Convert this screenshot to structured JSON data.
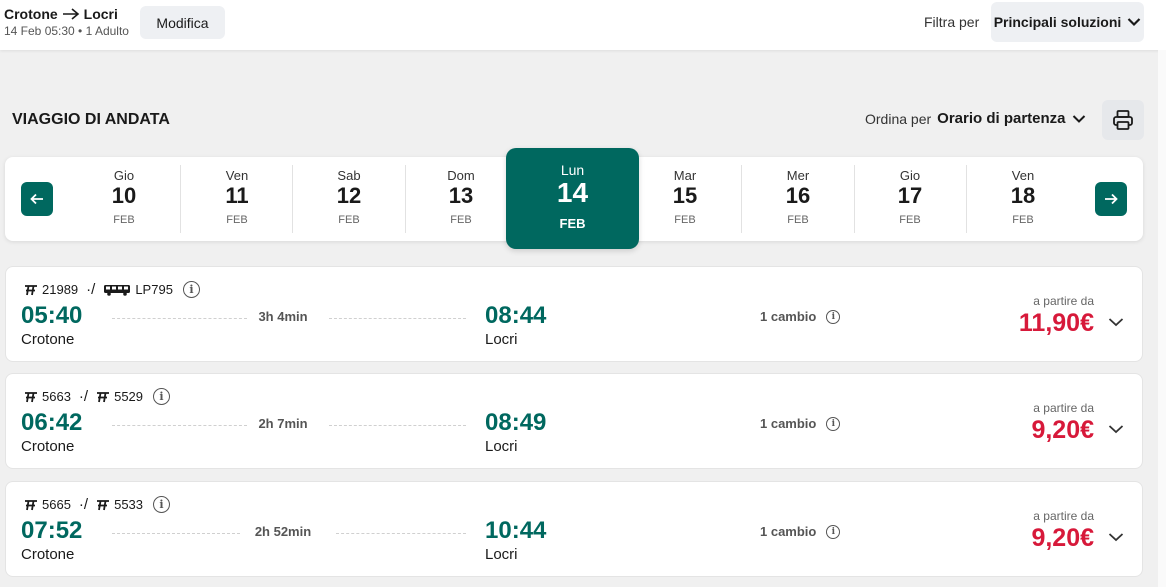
{
  "header": {
    "origin": "Crotone",
    "destination": "Locri",
    "details": "14 Feb 05:30 • 1 Adulto",
    "edit_label": "Modifica",
    "filter_label": "Filtra per",
    "filter_value": "Principali soluzioni"
  },
  "section": {
    "title": "VIAGGIO DI ANDATA",
    "sort_label": "Ordina per",
    "sort_value": "Orario di partenza"
  },
  "dates": [
    {
      "dow": "Gio",
      "num": "10",
      "mon": "FEB"
    },
    {
      "dow": "Ven",
      "num": "11",
      "mon": "FEB"
    },
    {
      "dow": "Sab",
      "num": "12",
      "mon": "FEB"
    },
    {
      "dow": "Dom",
      "num": "13",
      "mon": "FEB"
    },
    {
      "dow": "Lun",
      "num": "14",
      "mon": "FEB"
    },
    {
      "dow": "Mar",
      "num": "15",
      "mon": "FEB"
    },
    {
      "dow": "Mer",
      "num": "16",
      "mon": "FEB"
    },
    {
      "dow": "Gio",
      "num": "17",
      "mon": "FEB"
    },
    {
      "dow": "Ven",
      "num": "18",
      "mon": "FEB"
    }
  ],
  "active_date_index": 4,
  "results": [
    {
      "seg1": "21989",
      "seg1_icon": "train-icon",
      "seg2": "LP795",
      "seg2_icon": "bus-icon",
      "dep_time": "05:40",
      "dep_station": "Crotone",
      "duration": "3h 4min",
      "arr_time": "08:44",
      "arr_station": "Locri",
      "changes": "1 cambio",
      "price_label": "a partire da",
      "price": "11,90€"
    },
    {
      "seg1": "5663",
      "seg1_icon": "train-icon",
      "seg2": "5529",
      "seg2_icon": "train-icon",
      "dep_time": "06:42",
      "dep_station": "Crotone",
      "duration": "2h 7min",
      "arr_time": "08:49",
      "arr_station": "Locri",
      "changes": "1 cambio",
      "price_label": "a partire da",
      "price": "9,20€"
    },
    {
      "seg1": "5665",
      "seg1_icon": "train-icon",
      "seg2": "5533",
      "seg2_icon": "train-icon",
      "dep_time": "07:52",
      "dep_station": "Crotone",
      "duration": "2h 52min",
      "arr_time": "10:44",
      "arr_station": "Locri",
      "changes": "1 cambio",
      "price_label": "a partire da",
      "price": "9,20€"
    }
  ],
  "colors": {
    "accent": "#00685f",
    "price": "#d7193a"
  }
}
